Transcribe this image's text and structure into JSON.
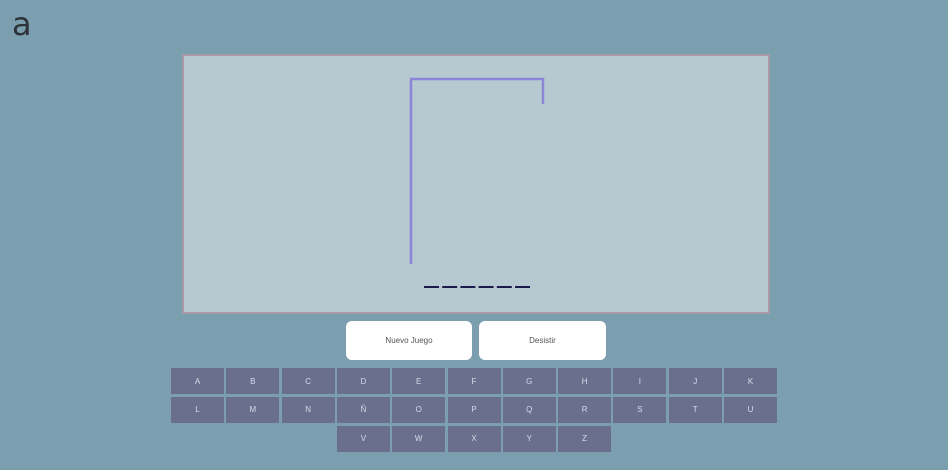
{
  "logo": {
    "text": "a",
    "icon": "logo-icon"
  },
  "game": {
    "word_length": 6,
    "gallows_color": "#8c84d6",
    "blank_color": "#1c1a4a"
  },
  "buttons": {
    "new_game": "Nuevo Juego",
    "give_up": "Desistir"
  },
  "keyboard": {
    "rows": [
      [
        "A",
        "B",
        "C",
        "D",
        "E",
        "F",
        "G",
        "H",
        "I",
        "J",
        "K"
      ],
      [
        "L",
        "M",
        "N",
        "Ñ",
        "O",
        "P",
        "Q",
        "R",
        "S",
        "T",
        "U"
      ],
      [
        "V",
        "W",
        "X",
        "Y",
        "Z"
      ]
    ]
  },
  "colors": {
    "background": "#7c9fb0",
    "board": "#b7c9d0",
    "board_border": "#a79aa6",
    "key": "#6b6f8e",
    "button": "#ffffff"
  }
}
